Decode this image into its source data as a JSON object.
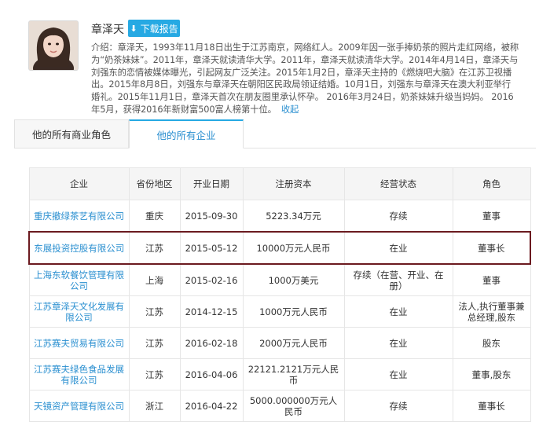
{
  "profile": {
    "name": "章泽天",
    "download_label": "下载报告",
    "intro_label": "介绍：",
    "intro_text": "章泽天，1993年11月18日出生于江苏南京，网络红人。2009年因一张手捧奶茶的照片走红网络，被称为“奶茶妹妹”。2011年，章泽天就读清华大学。2011年，章泽天就读清华大学。2014年4月14日，章泽天与刘强东的恋情被媒体曝光，引起网友广泛关注。2015年1月2日，章泽天主持的《燃烧吧大脑》在江苏卫视播出。2015年8月8日，刘强东与章泽天在朝阳区民政局领证结婚。10月1日，刘强东与章泽天在澳大利亚举行婚礼。2015年11月1日，章泽天首次在朋友圈里承认怀孕。 2016年3月24日，奶茶妹妹升级当妈妈。 2016年5月，获得2016年新财富500富人榜第十位。",
    "collapse_label": "收起"
  },
  "tabs": [
    {
      "label": "他的所有商业角色",
      "active": false
    },
    {
      "label": "他的所有企业",
      "active": true
    }
  ],
  "table": {
    "headers": [
      "企业",
      "省份地区",
      "开业日期",
      "注册资本",
      "经营状态",
      "角色"
    ],
    "rows": [
      [
        "重庆撤绿茶艺有限公司",
        "重庆",
        "2015-09-30",
        "5223.34万元",
        "存续",
        "董事"
      ],
      [
        "东展投资控股有限公司",
        "江苏",
        "2015-05-12",
        "10000万元人民币",
        "在业",
        "董事长"
      ],
      [
        "上海东软餐饮管理有限公司",
        "上海",
        "2015-02-16",
        "1000万美元",
        "存续（在营、开业、在册）",
        "董事"
      ],
      [
        "江苏章泽天文化发展有限公司",
        "江苏",
        "2014-12-15",
        "1000万元人民币",
        "在业",
        "法人,执行董事兼总经理,股东"
      ],
      [
        "江苏赛夫贸易有限公司",
        "江苏",
        "2016-02-18",
        "2000万元人民币",
        "在业",
        "股东"
      ],
      [
        "江苏赛夫绿色食品发展有限公司",
        "江苏",
        "2016-04-06",
        "22121.2121万元人民币",
        "在业",
        "董事,股东"
      ],
      [
        "天镜资产管理有限公司",
        "浙江",
        "2016-04-22",
        "5000.000000万元人民币",
        "存续",
        "董事长"
      ]
    ],
    "highlight_color": "#6b1a1f"
  },
  "colors": {
    "accent": "#26a9e3",
    "link": "#2a8fd0"
  }
}
